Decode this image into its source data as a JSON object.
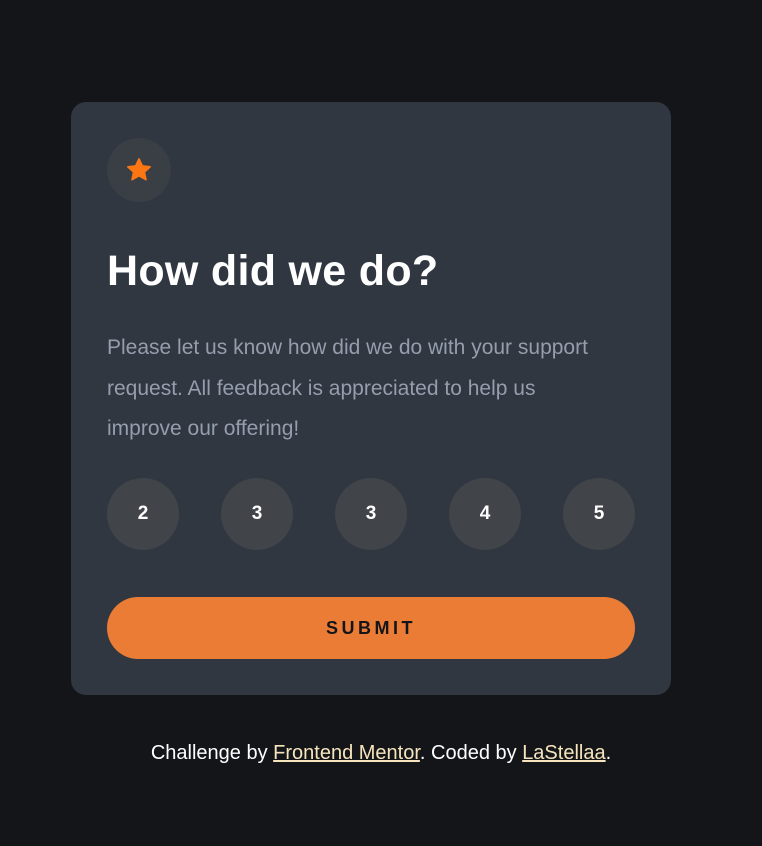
{
  "card": {
    "icon": "star-icon",
    "title": "How did we do?",
    "description": "Please let us know how did we do with your support request. All feedback is appreciated to help us improve our offering!",
    "ratings": [
      "2",
      "3",
      "3",
      "4",
      "5"
    ],
    "submit_label": "SUBMIT"
  },
  "attribution": {
    "prefix": "Challenge by ",
    "link1": "Frontend Mentor",
    "middle": ". Coded by ",
    "link2": "LaStellaa",
    "suffix": "."
  },
  "colors": {
    "page_background": "#131518",
    "card_background": "#303741",
    "accent": "#eb7c35",
    "rating_background": "#41454a",
    "link": "#f6e4bd"
  }
}
